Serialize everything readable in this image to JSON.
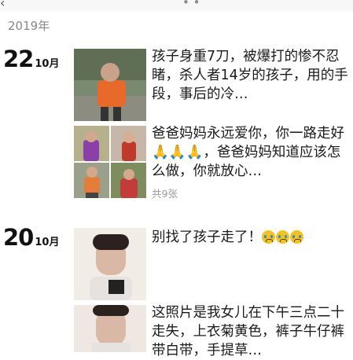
{
  "header": {
    "year": "2019年"
  },
  "posts": [
    {
      "day": "22",
      "month": "10月",
      "entries": [
        {
          "text": "孩子身重7刀，被爆打的惨不忍睹，杀人者14岁的孩子，用的手段，事后的冷…"
        },
        {
          "text": "爸爸妈妈永远爱你，你一路走好🙏🙏🙏，爸爸妈妈知道应该怎么做，你就放心…",
          "photo_count": "共9张"
        }
      ]
    },
    {
      "day": "20",
      "month": "10月",
      "entries": [
        {
          "text": "别找了孩子走了！",
          "emoji": [
            "crying-face",
            "crying-face",
            "crying-face"
          ]
        },
        {
          "text": "这照片是我女儿在下午三点二十走失，上衣菊黄色，裤子牛仔裤带白带，手提草…"
        }
      ]
    }
  ],
  "colors": {
    "accent_photo": "#e86a2a",
    "muted_text": "#888888"
  }
}
